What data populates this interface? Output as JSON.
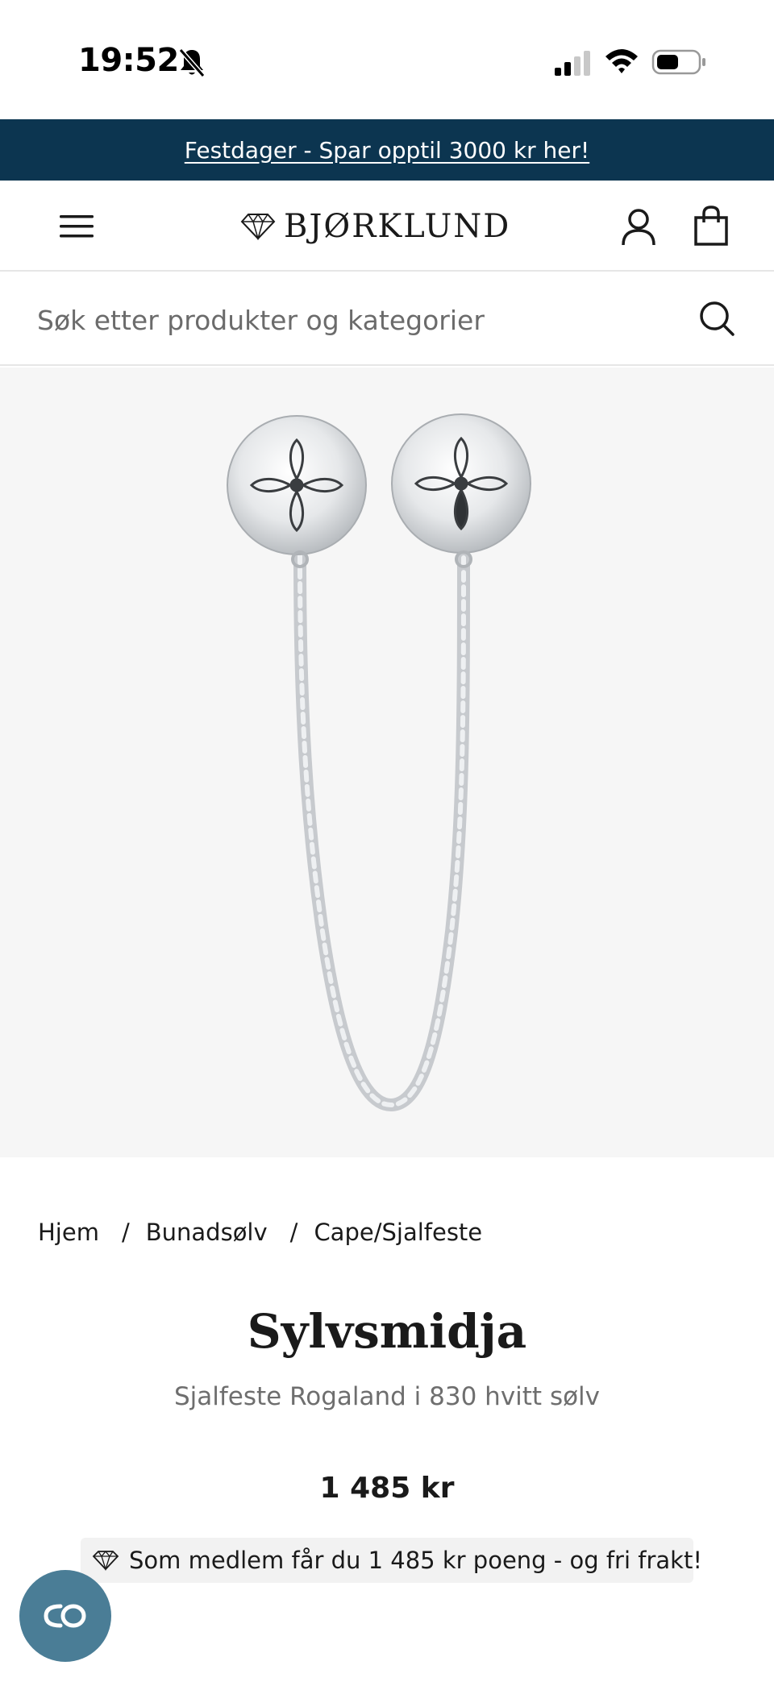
{
  "status_bar": {
    "time": "19:52",
    "icons": [
      "bell-off-icon",
      "signal-icon",
      "wifi-icon",
      "battery-icon"
    ]
  },
  "promo": {
    "text": "Festdager - Spar opptil 3000 kr her!",
    "background": "#0c3550"
  },
  "header": {
    "logo_text": "BJØRKLUND",
    "icons": [
      "menu-icon",
      "diamond-logo-icon",
      "account-icon",
      "bag-icon"
    ]
  },
  "search": {
    "placeholder": "Søk etter produkter og kategorier"
  },
  "breadcrumb": [
    {
      "label": "Hjem"
    },
    {
      "label": "Bunadsølv"
    },
    {
      "label": "Cape/Sjalfeste"
    }
  ],
  "product": {
    "brand": "Sylvsmidja",
    "name": "Sjalfeste Rogaland i 830 hvitt sølv",
    "price": "1 485 kr",
    "member_note": "Som medlem får du 1 485 kr poeng - og fri frakt!"
  },
  "chat": {
    "icon": "chat-co-icon",
    "color": "#4a7d96"
  }
}
